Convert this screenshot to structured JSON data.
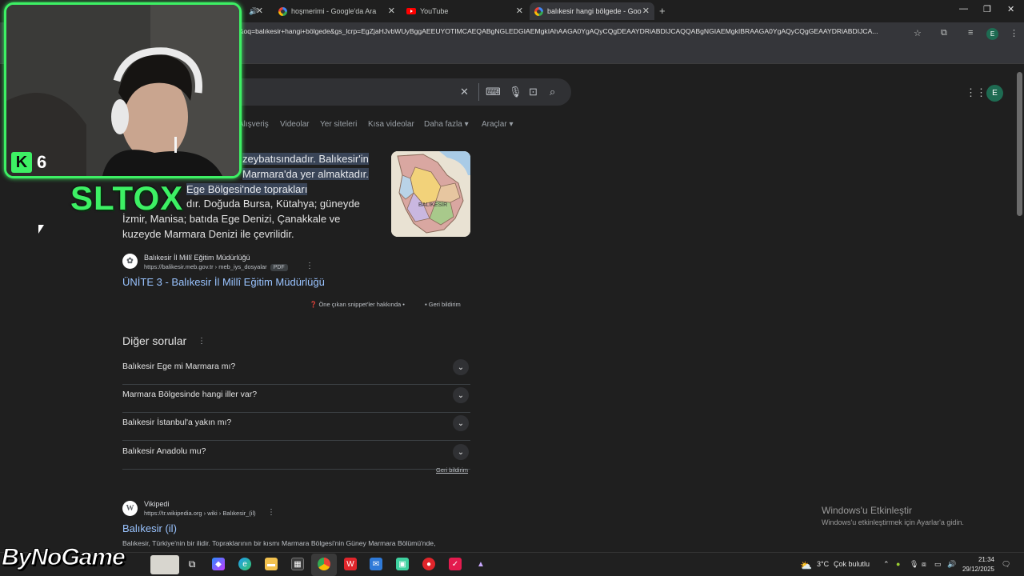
{
  "browser": {
    "tabs": [
      {
        "title": "hoşmerimi - Google'da Ara",
        "icon": "google-icon"
      },
      {
        "title": "YouTube",
        "icon": "youtube-icon"
      },
      {
        "title": "balıkesir hangi bölgede - Goog",
        "icon": "google-icon",
        "active": true
      }
    ],
    "new_tab": "+",
    "url": "e&oq=balıkesir+hangi+bölgede&gs_lcrp=EgZjaHJvbWUyBggAEEUYOTIMCAEQABgNGLEDGIAEMgkIAhAAGA0YgAQyCQgDEAAYDRiABDIJCAQQABgNGIAEMgkIBRAAGA0YgAQyCQgGEAAYDRiABDIJCA...",
    "profile_initial": "E"
  },
  "search": {
    "tabs": [
      "Alışveriş",
      "Videolar",
      "Yer siteleri",
      "Kısa videolar",
      "Daha fazla",
      "Araçlar"
    ],
    "avatar_initial": "E"
  },
  "snippet": {
    "line1_hl": "zeybatısındadır. Balıkesir'in",
    "line2_hl": "Marmara'da yer almaktadır.",
    "line3_hl": "Ege Bölgesi'nde toprakları",
    "line4_tail": "dır. Doğuda Bursa, Kütahya; güneyde",
    "line5": "İzmir, Manisa; batıda Ege Denizi, Çanakkale ve",
    "line6": "kuzeyde Marmara Denizi ile çevrilidir.",
    "map_label": "BALIKESİR",
    "source_name": "Balıkesir İl Millî Eğitim Müdürlüğü",
    "source_url": "https://balikesir.meb.gov.tr › meb_iys_dosyalar",
    "source_badge": "PDF",
    "link": "ÜNİTE 3 - Balıkesir İl Millî Eğitim Müdürlüğü",
    "about": "Öne çıkan snippet'ler hakkında",
    "feedback": "Geri bildirim"
  },
  "people_also_ask": {
    "title": "Diğer sorular",
    "questions": [
      "Balıkesir Ege mi Marmara mı?",
      "Marmara Bölgesinde hangi iller var?",
      "Balıkesir İstanbul'a yakın mı?",
      "Balıkesir Anadolu mu?"
    ],
    "feedback": "Geri bildirim"
  },
  "wiki_result": {
    "source_name": "Vikipedi",
    "source_url": "https://tr.wikipedia.org › wiki › Balıkesir_(il)",
    "link": "Balıkesir (il)",
    "description": "Balıkesir, Türkiye'nin bir ilidir. Topraklarının bir kısmı Marmara Bölgesi'nin Güney Marmara Bölümü'nde,"
  },
  "activation": {
    "title": "Windows'u Etkinleştir",
    "subtitle": "Windows'u etkinleştirmek için Ayarlar'a gidin."
  },
  "overlay": {
    "cam_letter": "K",
    "cam_number": "6",
    "streamer": "SLTOX",
    "sponsor": "ByNoGame"
  },
  "taskbar": {
    "weather_temp": "3°C",
    "weather_desc": "Çok bulutlu",
    "time": "21:34",
    "date": "29/12/2025"
  },
  "colors": {
    "accent_green": "#3df064",
    "link_blue": "#99c3ff",
    "highlight": "#394457"
  }
}
